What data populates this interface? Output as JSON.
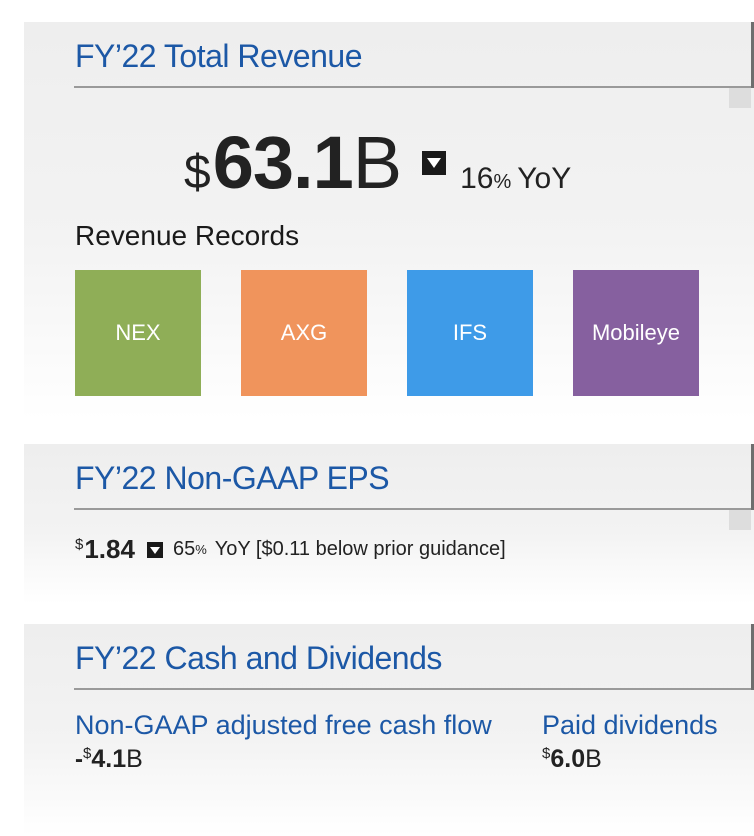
{
  "colors": {
    "title_blue": "#1c58a6",
    "tile_nex": "#8fae57",
    "tile_axg": "#f0945c",
    "tile_ifs": "#3e9be8",
    "tile_mobileye": "#86609f"
  },
  "revenue": {
    "title": "FY’22 Total Revenue",
    "currency": "$",
    "value": "63.1",
    "unit": "B",
    "direction_icon": "down-triangle-icon",
    "yoy_pct": "16",
    "pct_sign": "%",
    "yoy_label": "YoY",
    "records_label": "Revenue Records",
    "records": [
      {
        "label": "NEX",
        "color": "#8fae57"
      },
      {
        "label": "AXG",
        "color": "#f0945c"
      },
      {
        "label": "IFS",
        "color": "#3e9be8"
      },
      {
        "label": "Mobileye",
        "color": "#86609f"
      }
    ]
  },
  "eps": {
    "title": "FY’22 Non-GAAP EPS",
    "currency": "$",
    "value": "1.84",
    "direction_icon": "down-triangle-icon",
    "yoy_pct": "65",
    "pct_sign": "%",
    "detail": "YoY [$0.11 below prior guidance]"
  },
  "cash": {
    "title": "FY’22 Cash and Dividends",
    "fcf": {
      "label": "Non-GAAP adjusted free cash flow",
      "sign": "-",
      "currency": "$",
      "value": "4.1",
      "unit": "B"
    },
    "dividends": {
      "label": "Paid dividends",
      "currency": "$",
      "value": "6.0",
      "unit": "B"
    }
  }
}
